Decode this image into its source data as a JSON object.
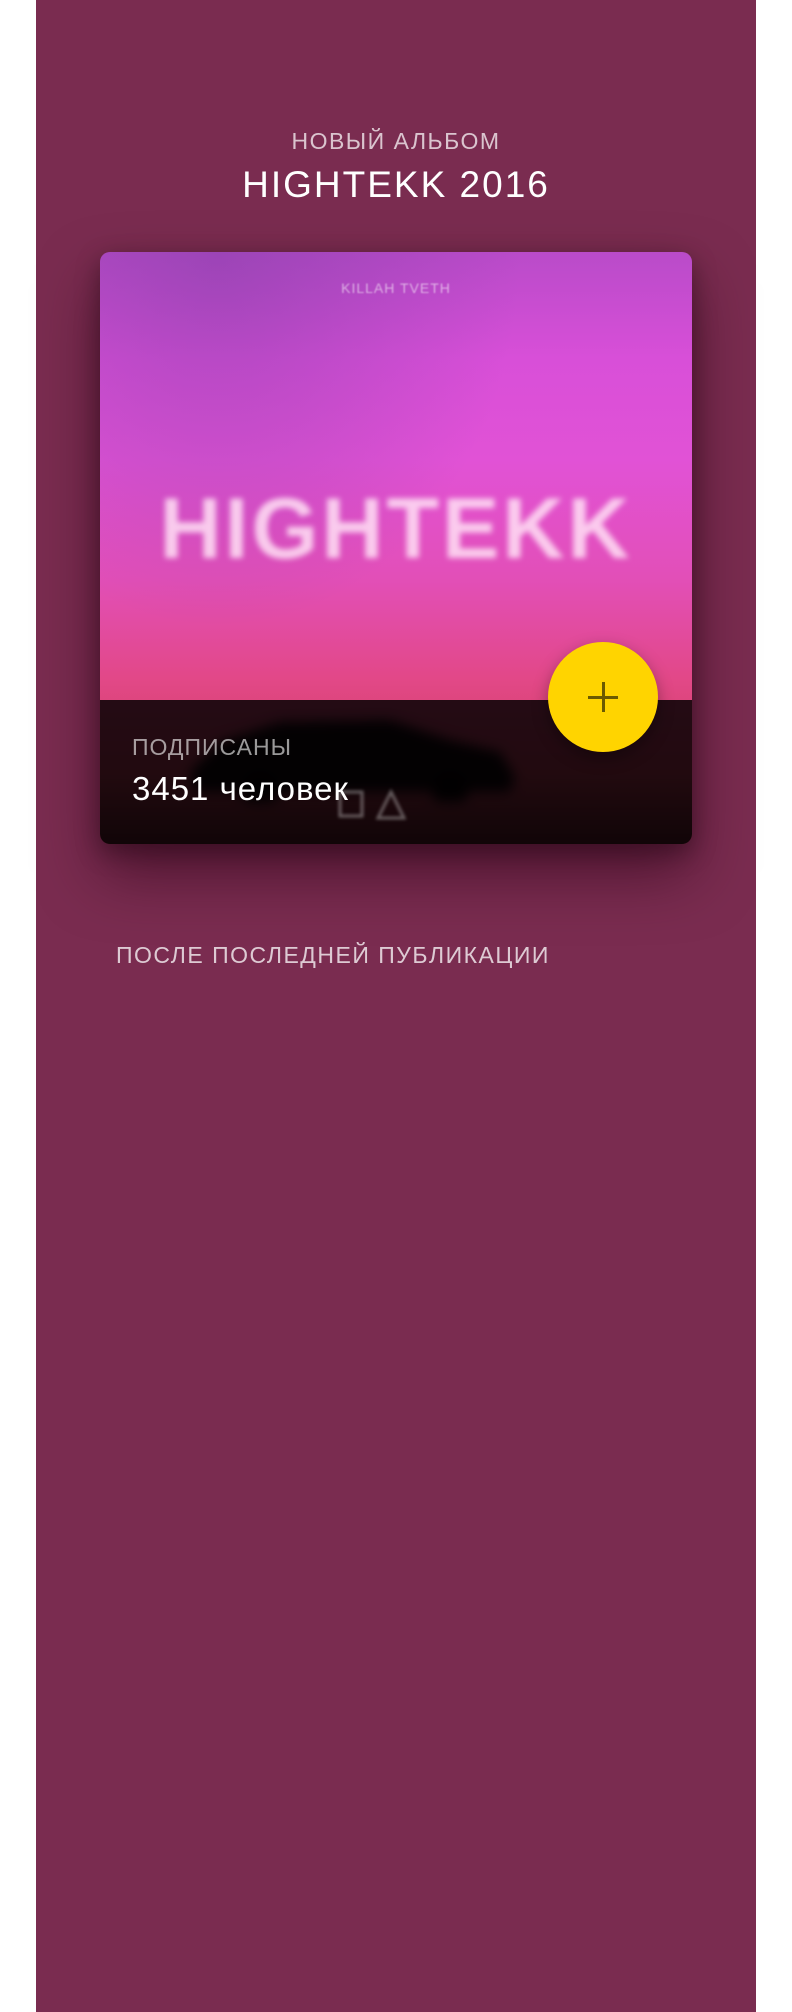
{
  "header": {
    "eyebrow": "НОВЫЙ АЛЬБОМ",
    "title": "HIGHTEKK 2016"
  },
  "album_card": {
    "cover_artist_text": "KILLAH TVETH",
    "cover_title_text": "HIGHTEKK",
    "subscribers_label": "ПОДПИСАНЫ",
    "subscribers_count": "3451 человек",
    "add_button_icon": "plus-icon"
  },
  "feed": {
    "section_heading": "ПОСЛЕ ПОСЛЕДНЕЙ ПУБЛИКАЦИИ"
  },
  "colors": {
    "background": "#7a2c50",
    "accent": "#ffd400",
    "panel": "#000000"
  }
}
